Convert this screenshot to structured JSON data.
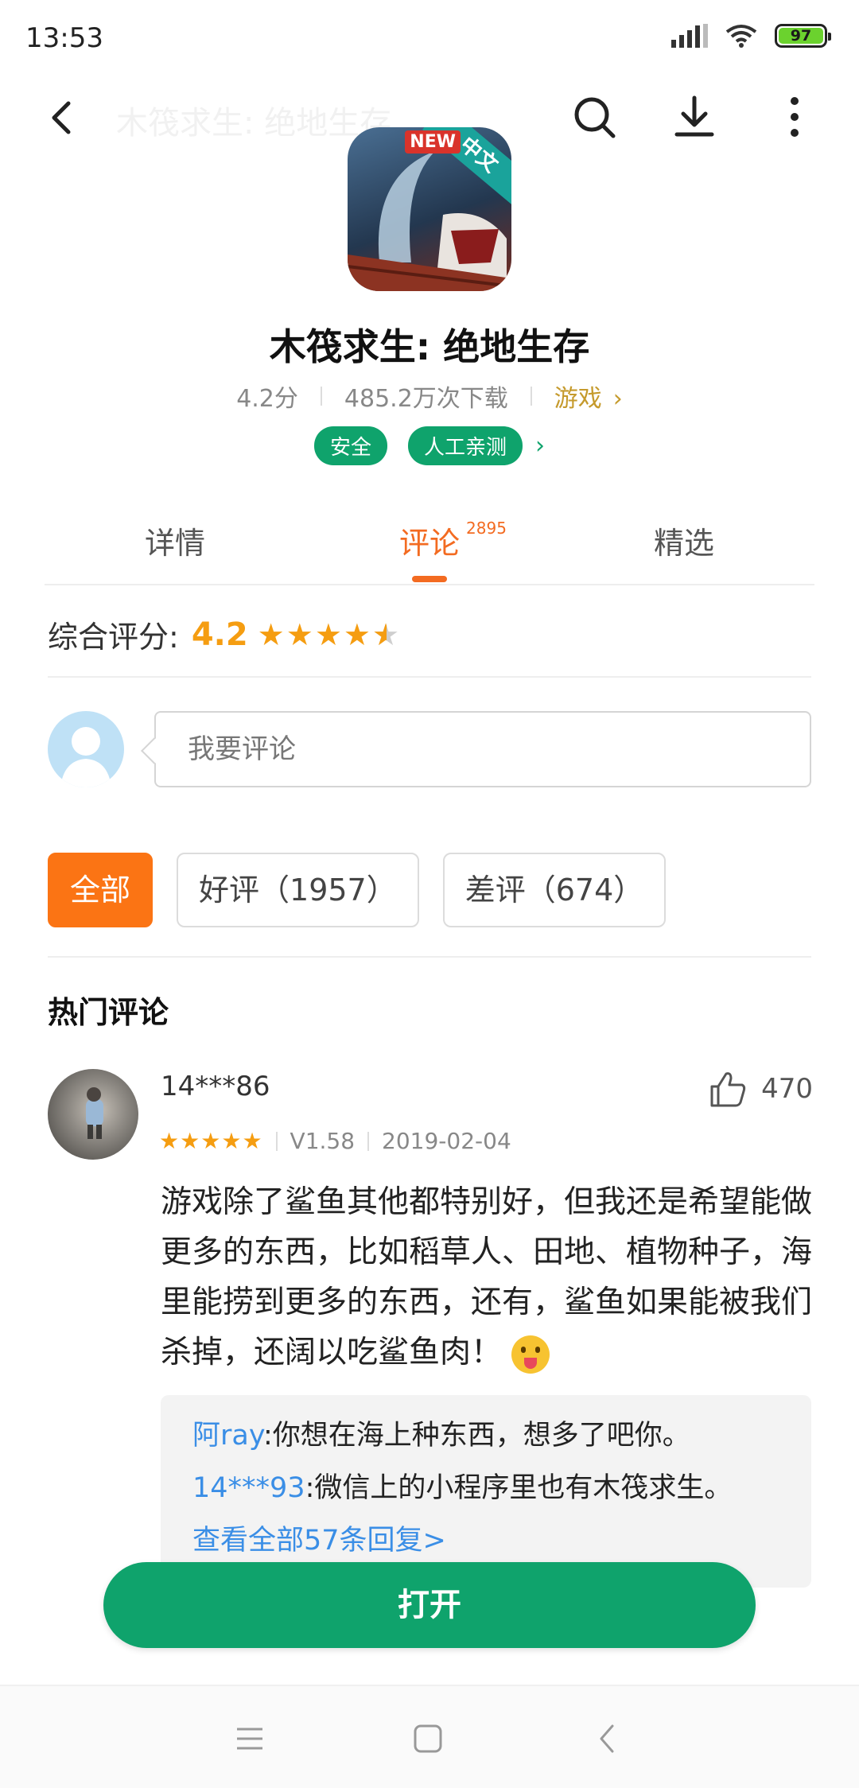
{
  "status_bar": {
    "time": "13:53",
    "battery": "97"
  },
  "top_bar": {
    "faded_title": "木筏求生: 绝地生存"
  },
  "app_icon": {
    "badge_text": "中文",
    "new_tag": "NEW"
  },
  "app": {
    "name": "木筏求生: 绝地生存",
    "rating": "4.2分",
    "downloads": "485.2万次下载",
    "category": "游戏",
    "badges": [
      "安全",
      "人工亲测"
    ]
  },
  "tabs": [
    {
      "label": "详情"
    },
    {
      "label": "评论",
      "count": "2895"
    },
    {
      "label": "精选"
    }
  ],
  "overall": {
    "label": "综合评分:",
    "score": "4.2",
    "stars_value": 4.2
  },
  "comment_box": {
    "placeholder": "我要评论"
  },
  "filters": [
    "全部",
    "好评（1957）",
    "差评（674）"
  ],
  "section_title": "热门评论",
  "review": {
    "user": "14***86",
    "likes": "470",
    "stars_value": 5,
    "version": "V1.58",
    "date": "2019-02-04",
    "text": "游戏除了鲨鱼其他都特别好，但我还是希望能做更多的东西，比如稻草人、田地、植物种子，海里能捞到更多的东西，还有，鲨鱼如果能被我们杀掉，还阔以吃鲨鱼肉！",
    "replies": [
      {
        "user": "阿ray",
        "text": ":你想在海上种东西，想多了吧你。"
      },
      {
        "user": "14***93",
        "text": ":微信上的小程序里也有木筏求生。"
      }
    ],
    "view_all": "查看全部57条回复>"
  },
  "open_button": "打开",
  "colors": {
    "accent": "#f36b21",
    "green": "#0fa36c",
    "star": "#f59d11",
    "link": "#3a8ee6"
  }
}
